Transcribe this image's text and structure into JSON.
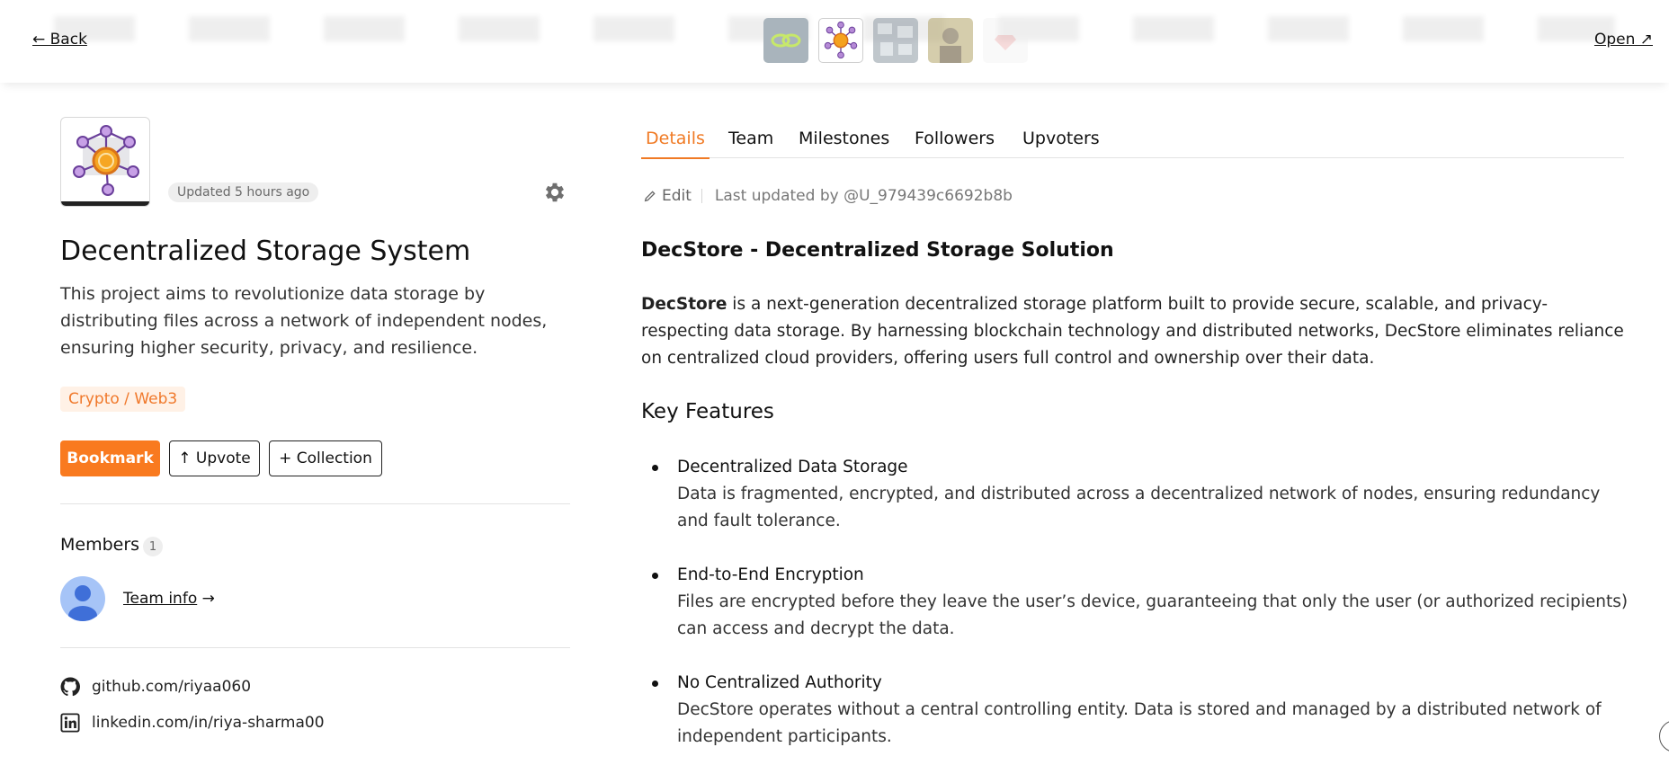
{
  "topbar": {
    "back_label": "← Back",
    "open_label": "Open ↗",
    "thumbnails": [
      {
        "name": "link-logo",
        "active": false
      },
      {
        "name": "network-logo",
        "active": true
      },
      {
        "name": "map-logo",
        "active": false
      },
      {
        "name": "portrait-logo",
        "active": false
      },
      {
        "name": "gem-logo",
        "active": false
      }
    ]
  },
  "project": {
    "updated": "Updated 5 hours ago",
    "title": "Decentralized Storage System",
    "description": "This project aims to revolutionize data storage by distributing files across a network of independent nodes, ensuring higher security, privacy, and resilience.",
    "category": "Crypto / Web3",
    "accent_color": "#f97a1f"
  },
  "actions": {
    "bookmark": "Bookmark",
    "upvote": "↑ Upvote",
    "collection": "+ Collection"
  },
  "members": {
    "label": "Members",
    "count": "1",
    "team_info": "Team info",
    "team_info_arrow": " →"
  },
  "links": {
    "github": "github.com/riyaa060",
    "linkedin": "linkedin.com/in/riya-sharma00"
  },
  "tabs": [
    "Details",
    "Team",
    "Milestones",
    "Followers",
    "Upvoters"
  ],
  "edit": {
    "label": "Edit",
    "last_updated": "Last updated by @U_979439c6692b8b"
  },
  "article": {
    "heading": "DecStore - Decentralized Storage Solution",
    "intro_bold": "DecStore",
    "intro_rest": " is a next-generation decentralized storage platform built to provide secure, scalable, and privacy-respecting data storage. By harnessing blockchain technology and distributed networks, DecStore eliminates reliance on centralized cloud providers, offering users full control and ownership over their data.",
    "features_heading": "Key Features",
    "features": [
      {
        "title": "Decentralized Data Storage",
        "desc": "Data is fragmented, encrypted, and distributed across a decentralized network of nodes, ensuring redundancy and fault tolerance."
      },
      {
        "title": "End-to-End Encryption",
        "desc": "Files are encrypted before they leave the user’s device, guaranteeing that only the user (or authorized recipients) can access and decrypt the data."
      },
      {
        "title": "No Centralized Authority",
        "desc": "DecStore operates without a central controlling entity. Data is stored and managed by a distributed network of independent participants."
      }
    ]
  }
}
